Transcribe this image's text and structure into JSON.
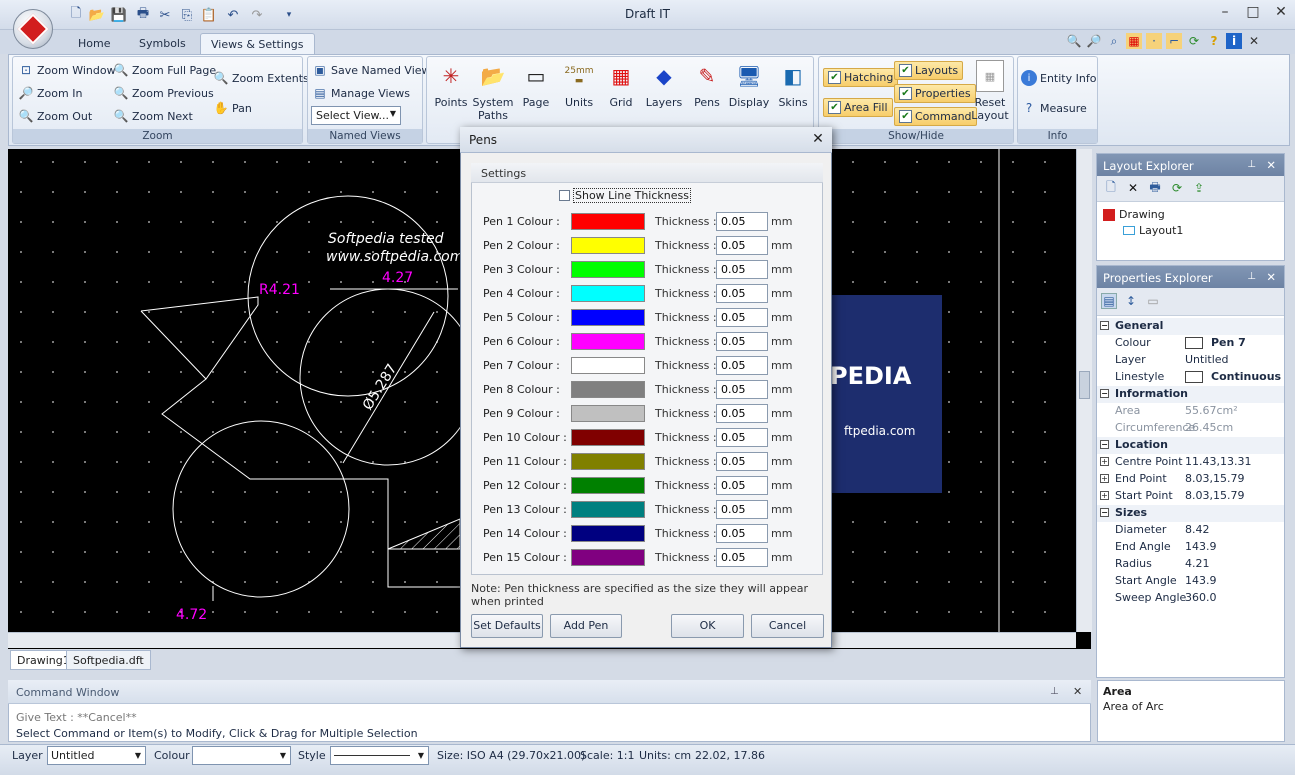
{
  "window": {
    "title": "Draft IT"
  },
  "ribbon_tabs": [
    "Home",
    "Symbols",
    "Views & Settings"
  ],
  "zoom_group": {
    "label": "Zoom",
    "buttons": [
      "Zoom Window",
      "Zoom Full Page",
      "Zoom Extents",
      "Zoom In",
      "Zoom Previous",
      "Pan",
      "Zoom Out",
      "Zoom Next"
    ]
  },
  "named_views": {
    "label": "Named Views",
    "save": "Save Named View",
    "manage": "Manage Views",
    "select_placeholder": "Select View..."
  },
  "settings_buttons": [
    {
      "label": "Points",
      "icon": "points-icon"
    },
    {
      "label": "System\nPaths",
      "icon": "folder-icon"
    },
    {
      "label": "Page",
      "icon": "page-icon"
    },
    {
      "label": "Units",
      "icon": "ruler-icon",
      "icon_text": "25mm"
    },
    {
      "label": "Grid",
      "icon": "grid-icon"
    },
    {
      "label": "Layers",
      "icon": "layers-icon"
    },
    {
      "label": "Pens",
      "icon": "pen-icon"
    },
    {
      "label": "Display",
      "icon": "monitor-icon"
    },
    {
      "label": "Skins",
      "icon": "skins-icon"
    }
  ],
  "show_hide": {
    "label": "Show/Hide",
    "checks": [
      {
        "label": "Hatching",
        "checked": true
      },
      {
        "label": "Area Fill",
        "checked": true
      },
      {
        "label": "Layouts",
        "checked": true
      },
      {
        "label": "Properties",
        "checked": true
      },
      {
        "label": "Command",
        "checked": true
      }
    ],
    "reset": "Reset\nLayout"
  },
  "info_group": {
    "label": "Info",
    "entity_info": "Entity Info",
    "measure": "Measure"
  },
  "drawing": {
    "text1": "Softpedia tested",
    "text2": "www.softpedia.com",
    "dim_r": "R4.21",
    "dim_len": "4.27",
    "dim_dia": "Ø5.287",
    "dim_bottom": "4.72",
    "logo_text": "PEDIA",
    "logo_url": "ftpedia.com",
    "watermark": "SOFTPEDIA"
  },
  "doc_tabs": [
    "Drawing1",
    "Softpedia.dft"
  ],
  "command_window": {
    "title": "Command Window",
    "line1": "Give Text :  **Cancel**",
    "line2": "Select Command or Item(s) to Modify, Click & Drag for Multiple Selection"
  },
  "status": {
    "layer_label": "Layer",
    "layer_value": "Untitled",
    "colour_label": "Colour",
    "colour_value": "",
    "style_label": "Style",
    "size": "Size: ISO A4 (29.70x21.00)",
    "scale": "Scale: 1:1",
    "units": "Units: cm",
    "coords": "22.02, 17.86"
  },
  "layout_explorer": {
    "title": "Layout Explorer",
    "root": "Drawing",
    "child": "Layout1"
  },
  "properties_explorer": {
    "title": "Properties Explorer",
    "rows": [
      {
        "type": "section",
        "k": "General"
      },
      {
        "k": "Colour",
        "v": "Pen 7",
        "swatch": "#ffffff",
        "bold": true
      },
      {
        "k": "Layer",
        "v": "Untitled"
      },
      {
        "k": "Linestyle",
        "v": "Continuous",
        "swatch": "#ffffff",
        "bold": true
      },
      {
        "type": "section",
        "k": "Information"
      },
      {
        "k": "Area",
        "v": "55.67cm²",
        "grey": true
      },
      {
        "k": "Circumference",
        "v": "26.45cm",
        "grey": true
      },
      {
        "type": "section",
        "k": "Location"
      },
      {
        "k": "Centre Point",
        "v": "11.43,13.31",
        "plus": true
      },
      {
        "k": "End Point",
        "v": "8.03,15.79",
        "plus": true
      },
      {
        "k": "Start Point",
        "v": "8.03,15.79",
        "plus": true
      },
      {
        "type": "section",
        "k": "Sizes"
      },
      {
        "k": "Diameter",
        "v": "8.42"
      },
      {
        "k": "End Angle",
        "v": "143.9"
      },
      {
        "k": "Radius",
        "v": "4.21"
      },
      {
        "k": "Start Angle",
        "v": "143.9"
      },
      {
        "k": "Sweep Angle",
        "v": "360.0"
      }
    ],
    "desc_title": "Area",
    "desc_text": "Area of Arc"
  },
  "pens_dialog": {
    "title": "Pens",
    "settings_title": "Settings",
    "show_line_thickness": "Show Line Thickness",
    "thickness_label": "Thickness :",
    "unit": "mm",
    "pens": [
      {
        "label": "Pen 1 Colour :",
        "color": "#ff0000",
        "thickness": "0.05"
      },
      {
        "label": "Pen 2 Colour :",
        "color": "#ffff00",
        "thickness": "0.05"
      },
      {
        "label": "Pen 3 Colour :",
        "color": "#00ff00",
        "thickness": "0.05"
      },
      {
        "label": "Pen 4 Colour :",
        "color": "#00ffff",
        "thickness": "0.05"
      },
      {
        "label": "Pen 5 Colour :",
        "color": "#0000ff",
        "thickness": "0.05"
      },
      {
        "label": "Pen 6 Colour :",
        "color": "#ff00ff",
        "thickness": "0.05"
      },
      {
        "label": "Pen 7 Colour :",
        "color": "#ffffff",
        "thickness": "0.05"
      },
      {
        "label": "Pen 8 Colour :",
        "color": "#808080",
        "thickness": "0.05"
      },
      {
        "label": "Pen 9 Colour :",
        "color": "#c0c0c0",
        "thickness": "0.05"
      },
      {
        "label": "Pen 10 Colour :",
        "color": "#800000",
        "thickness": "0.05"
      },
      {
        "label": "Pen 11 Colour :",
        "color": "#808000",
        "thickness": "0.05"
      },
      {
        "label": "Pen 12 Colour :",
        "color": "#008000",
        "thickness": "0.05"
      },
      {
        "label": "Pen 13 Colour :",
        "color": "#008080",
        "thickness": "0.05"
      },
      {
        "label": "Pen 14 Colour :",
        "color": "#000080",
        "thickness": "0.05"
      },
      {
        "label": "Pen 15 Colour :",
        "color": "#800080",
        "thickness": "0.05"
      }
    ],
    "note": "Note: Pen thickness are specified as the size they will appear when printed",
    "set_defaults": "Set Defaults",
    "add_pen": "Add Pen",
    "ok": "OK",
    "cancel": "Cancel"
  }
}
